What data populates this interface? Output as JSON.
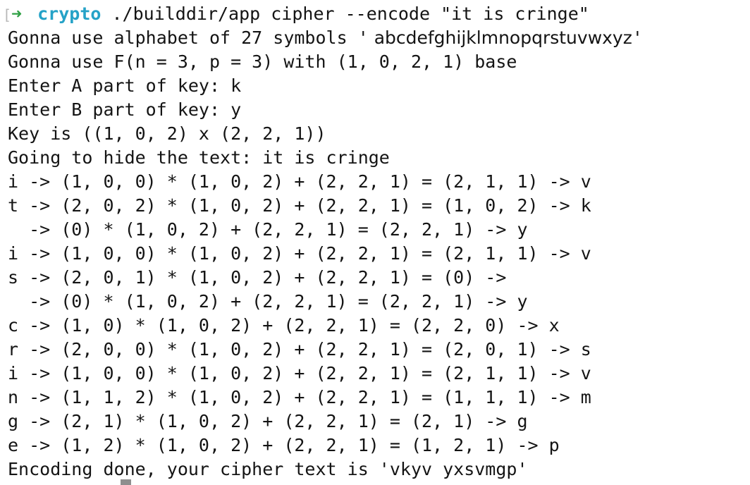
{
  "prompt": {
    "bracket": "[",
    "arrow": "➜",
    "directory": "crypto",
    "command": "./builddir/app cipher --encode \"it is cringe\""
  },
  "alphabet_line": {
    "prefix": "Gonna use alphabet of 27 symbols '",
    "alphabet": " abcdefghijklmnopqrstuvwxyz",
    "suffix": "'"
  },
  "lines": [
    "Gonna use F(n = 3, p = 3) with (1, 0, 2, 1) base",
    "Enter A part of key: k",
    "Enter B part of key: y",
    "Key is ((1, 0, 2) x (2, 2, 1))",
    "Going to hide the text: it is cringe",
    "i -> (1, 0, 0) * (1, 0, 2) + (2, 2, 1) = (2, 1, 1) -> v",
    "t -> (2, 0, 2) * (1, 0, 2) + (2, 2, 1) = (1, 0, 2) -> k",
    "  -> (0) * (1, 0, 2) + (2, 2, 1) = (2, 2, 1) -> y",
    "i -> (1, 0, 0) * (1, 0, 2) + (2, 2, 1) = (2, 1, 1) -> v",
    "s -> (2, 0, 1) * (1, 0, 2) + (2, 2, 1) = (0) ->",
    "  -> (0) * (1, 0, 2) + (2, 2, 1) = (2, 2, 1) -> y",
    "c -> (1, 0) * (1, 0, 2) + (2, 2, 1) = (2, 2, 0) -> x",
    "r -> (2, 0, 0) * (1, 0, 2) + (2, 2, 1) = (2, 0, 1) -> s",
    "i -> (1, 0, 0) * (1, 0, 2) + (2, 2, 1) = (2, 1, 1) -> v",
    "n -> (1, 1, 2) * (1, 0, 2) + (2, 2, 1) = (1, 1, 1) -> m",
    "g -> (2, 1) * (1, 0, 2) + (2, 2, 1) = (2, 1) -> g",
    "e -> (1, 2) * (1, 0, 2) + (2, 2, 1) = (1, 2, 1) -> p",
    "Encoding done, your cipher text is 'vkyv yxsvmgp'"
  ]
}
